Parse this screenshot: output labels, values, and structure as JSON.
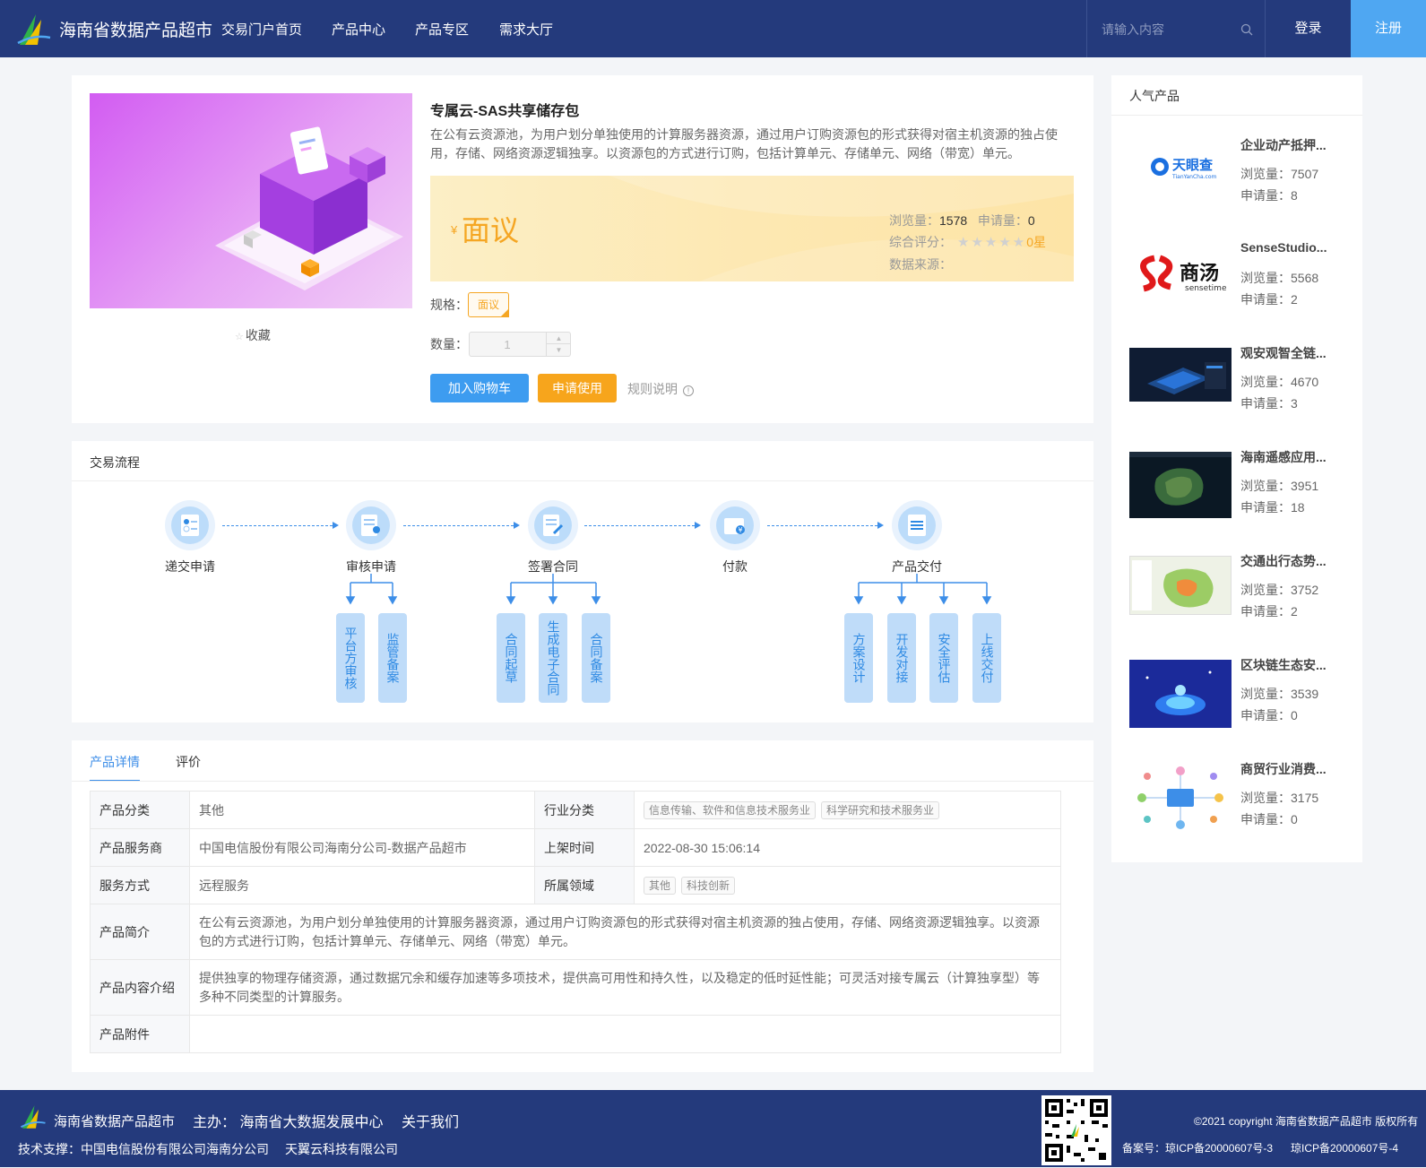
{
  "header": {
    "brand": "海南省数据产品超市",
    "nav": [
      "交易门户首页",
      "产品中心",
      "产品专区",
      "需求大厅"
    ],
    "search_placeholder": "请输入内容",
    "login": "登录",
    "register": "注册"
  },
  "product": {
    "title": "专属云-SAS共享储存包",
    "description": "在公有云资源池，为用户划分单独使用的计算服务器资源，通过用户订购资源包的形式获得对宿主机资源的独占使用，存储、网络资源逻辑独享。以资源包的方式进行订购，包括计算单元、存储单元、网络（带宽）单元。",
    "favorite": "收藏",
    "currency": "¥",
    "price": "面议",
    "views_label": "浏览量：",
    "views": "1578",
    "apply_label": "申请量：",
    "applies": "0",
    "rating_label": "综合评分：",
    "rating_text": "0星",
    "rating_value": 0,
    "source_label": "数据来源：",
    "spec_label": "规格：",
    "spec_value": "面议",
    "qty_label": "数量：",
    "qty_value": "1",
    "add_cart": "加入购物车",
    "apply_use": "申请使用",
    "rules": "规则说明"
  },
  "process": {
    "title": "交易流程",
    "steps": [
      "递交申请",
      "审核申请",
      "签署合同",
      "付款",
      "产品交付"
    ],
    "sub_review": [
      "平台方审核",
      "监管备案"
    ],
    "sub_contract": [
      "合同起草",
      "生成电子合同",
      "合同备案"
    ],
    "sub_delivery": [
      "方案设计",
      "开发对接",
      "安全评估",
      "上线交付"
    ]
  },
  "details": {
    "tabs": [
      "产品详情",
      "评价"
    ],
    "rows": {
      "category_k": "产品分类",
      "category_v": "其他",
      "industry_k": "行业分类",
      "industry_tags": [
        "信息传输、软件和信息技术服务业",
        "科学研究和技术服务业"
      ],
      "provider_k": "产品服务商",
      "provider_v": "中国电信股份有限公司海南分公司-数据产品超市",
      "listed_k": "上架时间",
      "listed_v": "2022-08-30 15:06:14",
      "service_k": "服务方式",
      "service_v": "远程服务",
      "domain_k": "所属领域",
      "domain_tags": [
        "其他",
        "科技创新"
      ],
      "intro_k": "产品简介",
      "intro_v": "在公有云资源池，为用户划分单独使用的计算服务器资源，通过用户订购资源包的形式获得对宿主机资源的独占使用，存储、网络资源逻辑独享。以资源包的方式进行订购，包括计算单元、存储单元、网络（带宽）单元。",
      "content_k": "产品内容介绍",
      "content_v": "提供独享的物理存储资源，通过数据冗余和缓存加速等多项技术，提供高可用性和持久性，以及稳定的低时延性能；可灵活对接专属云（计算独享型）等多种不同类型的计算服务。",
      "attach_k": "产品附件",
      "attach_v": ""
    }
  },
  "popular": {
    "title": "人气产品",
    "views_label": "浏览量：",
    "apply_label": "申请量：",
    "items": [
      {
        "name": "企业动产抵押...",
        "views": "7507",
        "applies": "8",
        "thumb": "tianyancha-logo"
      },
      {
        "name": "SenseStudio...",
        "views": "5568",
        "applies": "2",
        "thumb": "sensetime-logo"
      },
      {
        "name": "观安观智全链...",
        "views": "4670",
        "applies": "3",
        "thumb": "dark-dashboard"
      },
      {
        "name": "海南遥感应用...",
        "views": "3951",
        "applies": "18",
        "thumb": "satellite-map"
      },
      {
        "name": "交通出行态势...",
        "views": "3752",
        "applies": "2",
        "thumb": "traffic-map"
      },
      {
        "name": "区块链生态安...",
        "views": "3539",
        "applies": "0",
        "thumb": "blockchain-art"
      },
      {
        "name": "商贸行业消费...",
        "views": "3175",
        "applies": "0",
        "thumb": "network-diagram"
      }
    ],
    "logo_text_1": "天眼查",
    "logo_text_1b": "TianYanCha.com",
    "logo_text_2": "商汤",
    "logo_text_2b": "sensetime"
  },
  "footer": {
    "brand": "海南省数据产品超市",
    "host": "主办： 海南省大数据发展中心",
    "about": "关于我们",
    "support": "技术支撑：中国电信股份有限公司海南分公司",
    "support2": "天翼云科技有限公司",
    "copyright": "©2021 copyright 海南省数据产品超市 版权所有",
    "icp1": "备案号：琼ICP备20000607号-3",
    "icp2": "琼ICP备20000607号-4"
  }
}
